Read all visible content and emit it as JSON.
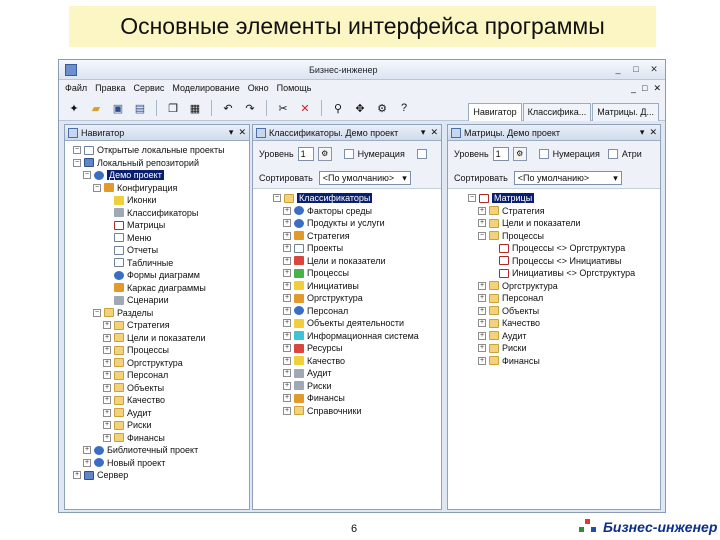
{
  "slide": {
    "title": "Основные элементы интерфейса программы",
    "page_number": "6",
    "brand": "Бизнес-инженер"
  },
  "window": {
    "title": "Бизнес-инженер",
    "controls": [
      "_",
      "□",
      "✕"
    ]
  },
  "menu": {
    "items": [
      "Файл",
      "Правка",
      "Сервис",
      "Моделирование",
      "Окно",
      "Помощь"
    ],
    "right_controls": [
      "_",
      "□",
      "✕"
    ]
  },
  "toolbar": {
    "tabs": [
      "Навигатор",
      "Классифика...",
      "Матрицы. Д..."
    ]
  },
  "navigator": {
    "title": "Навигатор",
    "items": [
      {
        "label": "Открытые локальные проекты",
        "depth": 0,
        "icon": "page",
        "exp": "-"
      },
      {
        "label": "Локальный репозиторий",
        "depth": 0,
        "icon": "db",
        "exp": "-"
      },
      {
        "label": "Демо проект",
        "depth": 1,
        "icon": "blue",
        "exp": "-",
        "selected": true
      },
      {
        "label": "Конфигурация",
        "depth": 2,
        "icon": "orange",
        "exp": "-"
      },
      {
        "label": "Иконки",
        "depth": 3,
        "icon": "yellow",
        "exp": ""
      },
      {
        "label": "Классификаторы",
        "depth": 3,
        "icon": "gray",
        "exp": ""
      },
      {
        "label": "Матрицы",
        "depth": 3,
        "icon": "grid",
        "exp": ""
      },
      {
        "label": "Меню",
        "depth": 3,
        "icon": "page",
        "exp": ""
      },
      {
        "label": "Отчеты",
        "depth": 3,
        "icon": "page",
        "exp": ""
      },
      {
        "label": "Табличные",
        "depth": 3,
        "icon": "page",
        "exp": ""
      },
      {
        "label": "Формы диаграмм",
        "depth": 3,
        "icon": "blue",
        "exp": ""
      },
      {
        "label": "Каркас диаграммы",
        "depth": 3,
        "icon": "orange",
        "exp": ""
      },
      {
        "label": "Сценарии",
        "depth": 3,
        "icon": "gray",
        "exp": ""
      },
      {
        "label": "Разделы",
        "depth": 2,
        "icon": "folder",
        "exp": "-"
      },
      {
        "label": "Стратегия",
        "depth": 3,
        "icon": "folder",
        "exp": "+"
      },
      {
        "label": "Цели и показатели",
        "depth": 3,
        "icon": "folder",
        "exp": "+"
      },
      {
        "label": "Процессы",
        "depth": 3,
        "icon": "folder",
        "exp": "+"
      },
      {
        "label": "Оргструктура",
        "depth": 3,
        "icon": "folder",
        "exp": "+"
      },
      {
        "label": "Персонал",
        "depth": 3,
        "icon": "folder",
        "exp": "+"
      },
      {
        "label": "Объекты",
        "depth": 3,
        "icon": "folder",
        "exp": "+"
      },
      {
        "label": "Качество",
        "depth": 3,
        "icon": "folder",
        "exp": "+"
      },
      {
        "label": "Аудит",
        "depth": 3,
        "icon": "folder",
        "exp": "+"
      },
      {
        "label": "Риски",
        "depth": 3,
        "icon": "folder",
        "exp": "+"
      },
      {
        "label": "Финансы",
        "depth": 3,
        "icon": "folder",
        "exp": "+"
      },
      {
        "label": "Библиотечный проект",
        "depth": 1,
        "icon": "blue",
        "exp": "+"
      },
      {
        "label": "Новый проект",
        "depth": 1,
        "icon": "blue",
        "exp": "+"
      },
      {
        "label": "Сервер",
        "depth": 0,
        "icon": "db",
        "exp": "+"
      }
    ]
  },
  "classifiers": {
    "title": "Классификаторы. Демо проект",
    "level_label": "Уровень",
    "level_value": "1",
    "numbering_label": "Нумерация",
    "sort_label": "Сортировать",
    "sort_value": "<По умолчанию>",
    "items": [
      {
        "label": "Классификаторы",
        "depth": 0,
        "icon": "folder",
        "exp": "-",
        "selected": true
      },
      {
        "label": "Факторы среды",
        "depth": 1,
        "icon": "blue",
        "exp": "+"
      },
      {
        "label": "Продукты и услуги",
        "depth": 1,
        "icon": "blue",
        "exp": "+"
      },
      {
        "label": "Стратегия",
        "depth": 1,
        "icon": "orange",
        "exp": "+"
      },
      {
        "label": "Проекты",
        "depth": 1,
        "icon": "page",
        "exp": "+"
      },
      {
        "label": "Цели и показатели",
        "depth": 1,
        "icon": "red",
        "exp": "+"
      },
      {
        "label": "Процессы",
        "depth": 1,
        "icon": "green",
        "exp": "+"
      },
      {
        "label": "Инициативы",
        "depth": 1,
        "icon": "yellow",
        "exp": "+"
      },
      {
        "label": "Оргструктура",
        "depth": 1,
        "icon": "orange",
        "exp": "+"
      },
      {
        "label": "Персонал",
        "depth": 1,
        "icon": "blue",
        "exp": "+"
      },
      {
        "label": "Объекты деятельности",
        "depth": 1,
        "icon": "yellow",
        "exp": "+"
      },
      {
        "label": "Информационная система",
        "depth": 1,
        "icon": "cyan",
        "exp": "+"
      },
      {
        "label": "Ресурсы",
        "depth": 1,
        "icon": "red",
        "exp": "+"
      },
      {
        "label": "Качество",
        "depth": 1,
        "icon": "yellow",
        "exp": "+"
      },
      {
        "label": "Аудит",
        "depth": 1,
        "icon": "gray",
        "exp": "+"
      },
      {
        "label": "Риски",
        "depth": 1,
        "icon": "gray",
        "exp": "+"
      },
      {
        "label": "Финансы",
        "depth": 1,
        "icon": "orange",
        "exp": "+"
      },
      {
        "label": "Справочники",
        "depth": 1,
        "icon": "folder",
        "exp": "+"
      }
    ]
  },
  "matrices": {
    "title": "Матрицы. Демо проект",
    "level_label": "Уровень",
    "level_value": "1",
    "numbering_label": "Нумерация",
    "extra_label": "Атри",
    "sort_label": "Сортировать",
    "sort_value": "<По умолчанию>",
    "items": [
      {
        "label": "Матрицы",
        "depth": 0,
        "icon": "grid",
        "exp": "-",
        "selected": true
      },
      {
        "label": "Стратегия",
        "depth": 1,
        "icon": "folder",
        "exp": "+"
      },
      {
        "label": "Цели и показатели",
        "depth": 1,
        "icon": "folder",
        "exp": "+"
      },
      {
        "label": "Процессы",
        "depth": 1,
        "icon": "folder",
        "exp": "-"
      },
      {
        "label": "Процессы <> Оргструктура",
        "depth": 2,
        "icon": "grid",
        "exp": ""
      },
      {
        "label": "Процессы <> Инициативы",
        "depth": 2,
        "icon": "grid",
        "exp": ""
      },
      {
        "label": "Инициативы <> Оргструктура",
        "depth": 2,
        "icon": "grid",
        "exp": ""
      },
      {
        "label": "Оргструктура",
        "depth": 1,
        "icon": "folder",
        "exp": "+"
      },
      {
        "label": "Персонал",
        "depth": 1,
        "icon": "folder",
        "exp": "+"
      },
      {
        "label": "Объекты",
        "depth": 1,
        "icon": "folder",
        "exp": "+"
      },
      {
        "label": "Качество",
        "depth": 1,
        "icon": "folder",
        "exp": "+"
      },
      {
        "label": "Аудит",
        "depth": 1,
        "icon": "folder",
        "exp": "+"
      },
      {
        "label": "Риски",
        "depth": 1,
        "icon": "folder",
        "exp": "+"
      },
      {
        "label": "Финансы",
        "depth": 1,
        "icon": "folder",
        "exp": "+"
      }
    ]
  }
}
